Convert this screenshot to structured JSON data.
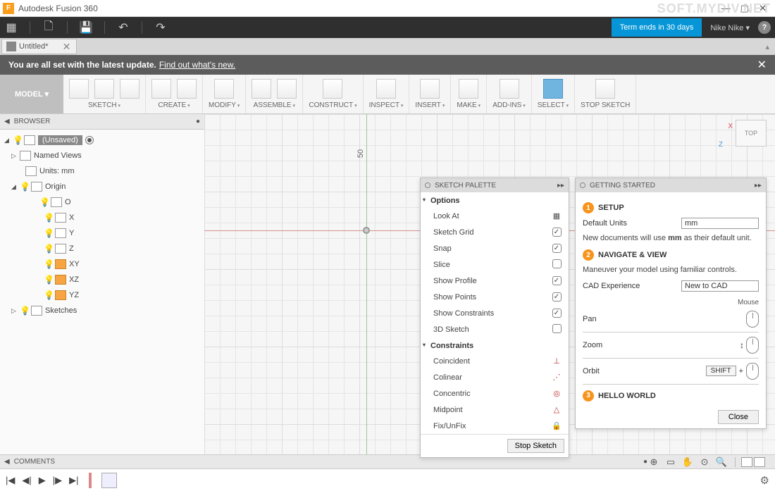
{
  "app": {
    "title": "Autodesk Fusion 360"
  },
  "windowControls": {
    "min": "—",
    "max": "▢",
    "close": "✕"
  },
  "qat": {
    "grid": "▦",
    "new": "🗋",
    "save": "💾",
    "undo": "↶",
    "redo": "↷",
    "term": "Term ends in 30 days",
    "user": "Nike Nike ▾",
    "help": "?"
  },
  "tabs": {
    "doc": "Untitled*",
    "close": "✕",
    "collapse": "▴"
  },
  "banner": {
    "text": "You are all set with the latest update.",
    "link": "Find out what's new.",
    "close": "✕"
  },
  "workspace": "MODEL ▾",
  "ribbon": [
    {
      "label": "SKETCH",
      "icons": 3
    },
    {
      "label": "CREATE",
      "icons": 2
    },
    {
      "label": "MODIFY",
      "icons": 1
    },
    {
      "label": "ASSEMBLE",
      "icons": 2
    },
    {
      "label": "CONSTRUCT",
      "icons": 1
    },
    {
      "label": "INSPECT",
      "icons": 1
    },
    {
      "label": "INSERT",
      "icons": 1
    },
    {
      "label": "MAKE",
      "icons": 1
    },
    {
      "label": "ADD-INS",
      "icons": 1
    },
    {
      "label": "SELECT",
      "icons": 1,
      "selected": true
    },
    {
      "label": "STOP SKETCH",
      "icons": 1,
      "noarrow": true
    }
  ],
  "browser": {
    "title": "BROWSER",
    "gear": "●",
    "root": "(Unsaved)",
    "items": {
      "namedViews": "Named Views",
      "units": "Units: mm",
      "origin": "Origin",
      "axes": [
        "O",
        "X",
        "Y",
        "Z",
        "XY",
        "XZ",
        "YZ"
      ],
      "sketches": "Sketches"
    }
  },
  "canvas": {
    "dim": "50",
    "viewcube": "TOP",
    "x": "X",
    "z": "Z"
  },
  "sketchPalette": {
    "title": "SKETCH PALETTE",
    "sections": {
      "options": "Options",
      "constraints": "Constraints"
    },
    "options": [
      {
        "label": "Look At",
        "ctrl": "icon"
      },
      {
        "label": "Sketch Grid",
        "ctrl": "check",
        "on": true
      },
      {
        "label": "Snap",
        "ctrl": "check",
        "on": true
      },
      {
        "label": "Slice",
        "ctrl": "check",
        "on": false
      },
      {
        "label": "Show Profile",
        "ctrl": "check",
        "on": true
      },
      {
        "label": "Show Points",
        "ctrl": "check",
        "on": true
      },
      {
        "label": "Show Constraints",
        "ctrl": "check",
        "on": true
      },
      {
        "label": "3D Sketch",
        "ctrl": "check",
        "on": false
      }
    ],
    "constraints": [
      {
        "label": "Coincident",
        "glyph": "⊥",
        "color": "#b03030"
      },
      {
        "label": "Colinear",
        "glyph": "⋰",
        "color": "#b03030"
      },
      {
        "label": "Concentric",
        "glyph": "◎",
        "color": "#c03030"
      },
      {
        "label": "Midpoint",
        "glyph": "△",
        "color": "#c03030"
      },
      {
        "label": "Fix/UnFix",
        "glyph": "🔒",
        "color": "#e08020"
      }
    ],
    "footer": "Stop Sketch"
  },
  "gettingStarted": {
    "title": "GETTING STARTED",
    "steps": {
      "setup": {
        "num": "1",
        "title": "SETUP"
      },
      "nav": {
        "num": "2",
        "title": "NAVIGATE & VIEW"
      },
      "hello": {
        "num": "3",
        "title": "HELLO WORLD"
      }
    },
    "defaultUnits": {
      "label": "Default Units",
      "value": "mm"
    },
    "unitsNote": "New documents will use mm as their default unit.",
    "navNote": "Maneuver your model using familiar controls.",
    "cadExp": {
      "label": "CAD Experience",
      "value": "New to CAD"
    },
    "mouseLabel": "Mouse",
    "controls": {
      "pan": "Pan",
      "zoom": "Zoom",
      "orbit": "Orbit",
      "shift": "SHIFT",
      "plus": "+"
    },
    "close": "Close"
  },
  "comments": {
    "title": "COMMENTS"
  },
  "timeline": {
    "gear": "⚙"
  },
  "watermark": "SOFT.MYDIV.NET"
}
